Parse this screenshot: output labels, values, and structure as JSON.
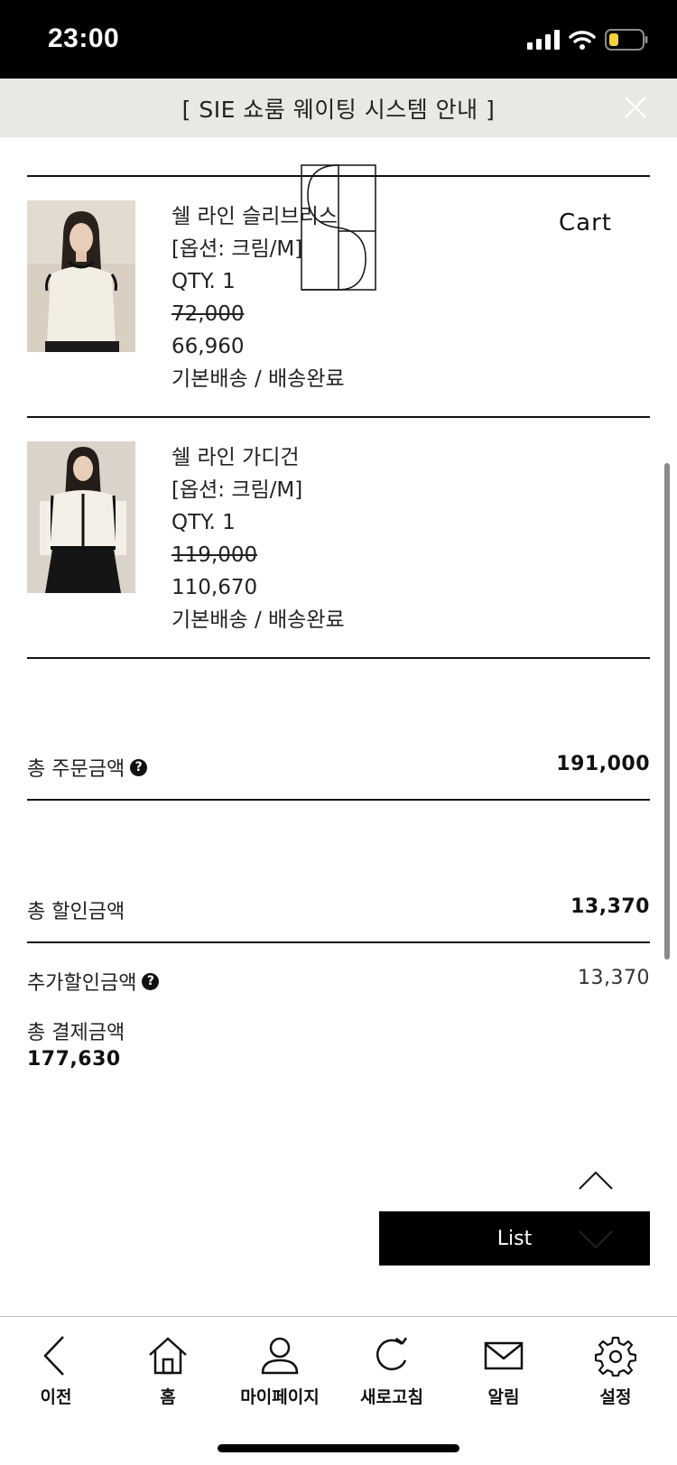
{
  "status_bar": {
    "time": "23:00"
  },
  "notice": {
    "text": "[ SIE 쇼룸 웨이팅 시스템 안내 ]"
  },
  "header": {
    "cart_label": "Cart"
  },
  "products": [
    {
      "name": "쉘 라인 슬리브리스",
      "option": "[옵션: 크림/M]",
      "qty": "QTY. 1",
      "original_price": "72,000",
      "sale_price": "66,960",
      "shipping": "기본배송 / 배송완료"
    },
    {
      "name": "쉘 라인 가디건",
      "option": "[옵션: 크림/M]",
      "qty": "QTY. 1",
      "original_price": "119,000",
      "sale_price": "110,670",
      "shipping": "기본배송 / 배송완료"
    }
  ],
  "summary": {
    "total_order_label": "총 주문금액",
    "total_order_value": "191,000",
    "total_discount_label": "총 할인금액",
    "total_discount_value": "13,370",
    "extra_discount_label": "추가할인금액",
    "extra_discount_value": "13,370",
    "total_payment_label": "총 결제금액",
    "total_payment_value": "177,630"
  },
  "actions": {
    "list_label": "List"
  },
  "bottom_nav": {
    "items": [
      {
        "label": "이전",
        "icon": "back-icon"
      },
      {
        "label": "홈",
        "icon": "home-icon"
      },
      {
        "label": "마이페이지",
        "icon": "person-icon"
      },
      {
        "label": "새로고침",
        "icon": "refresh-icon"
      },
      {
        "label": "알림",
        "icon": "mail-icon"
      },
      {
        "label": "설정",
        "icon": "gear-icon"
      }
    ]
  },
  "colors": {
    "banner_bg": "#e8e8e4",
    "button_bg": "#000000",
    "text": "#111111"
  }
}
